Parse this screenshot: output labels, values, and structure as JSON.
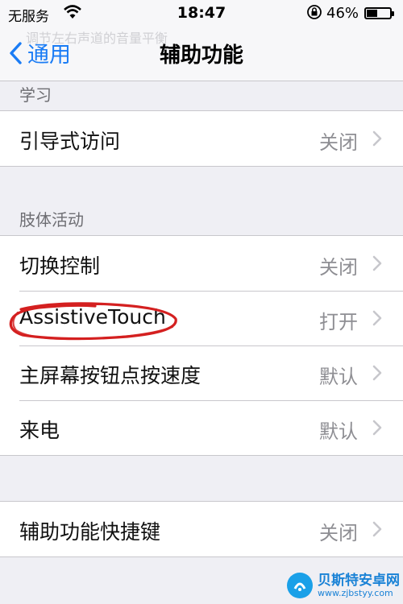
{
  "status": {
    "carrier": "无服务",
    "time": "18:47",
    "battery": "46%",
    "battery_level": 0.46
  },
  "nav": {
    "ghost_text": "调节左右声道的音量平衡",
    "back_label": "通用",
    "title": "辅助功能"
  },
  "sections": {
    "learning": "学习",
    "physical": "肢体活动"
  },
  "rows": {
    "guided_access": {
      "label": "引导式访问",
      "value": "关闭"
    },
    "switch_control": {
      "label": "切换控制",
      "value": "关闭"
    },
    "assistive_touch": {
      "label": "AssistiveTouch",
      "value": "打开"
    },
    "home_click_speed": {
      "label": "主屏幕按钮点按速度",
      "value": "默认"
    },
    "call_audio": {
      "label": "来电",
      "value": "默认"
    },
    "shortcut": {
      "label": "辅助功能快捷键",
      "value": "关闭"
    }
  },
  "icons": [
    "wifi-icon",
    "rotation-lock-icon",
    "battery-icon",
    "chevron-left-icon",
    "chevron-right-icon"
  ],
  "colors": {
    "accent": "#1a7cf5",
    "annotation": "#d42020",
    "background": "#efeff4"
  },
  "watermark": {
    "brand": "贝斯特安卓网",
    "url": "www.zjbstyy.com"
  }
}
